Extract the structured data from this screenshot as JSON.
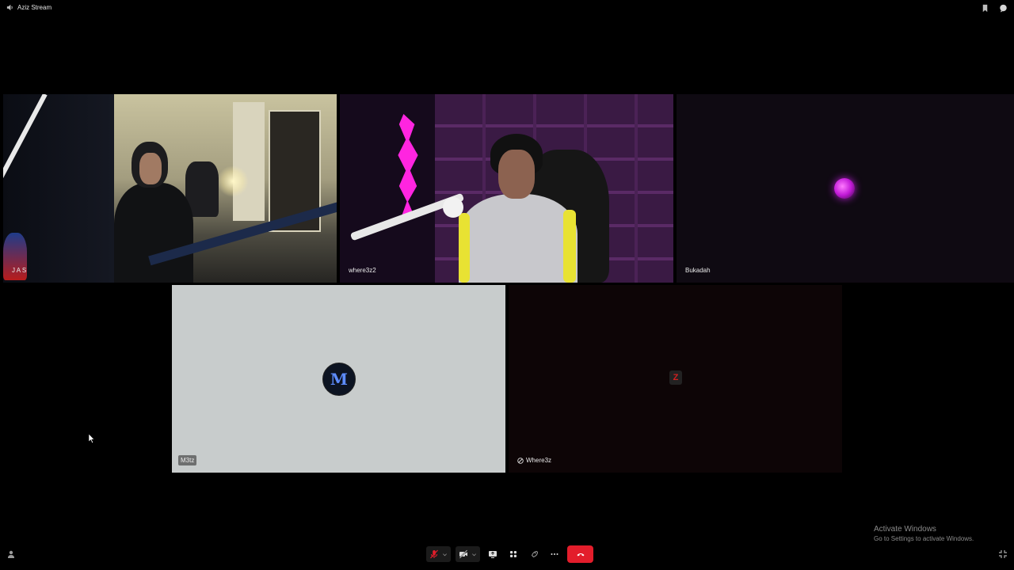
{
  "window": {
    "title": "Aziz Stream"
  },
  "participants": [
    {
      "name": "J A S"
    },
    {
      "name": "where3z2"
    },
    {
      "name": "Bukadah"
    },
    {
      "name": "M3tz"
    },
    {
      "name": "Where3z"
    }
  ],
  "m3tz_avatar_letter": "M",
  "where3z_avatar_letter": "Z",
  "system_watermark": {
    "line1": "Activate Windows",
    "line2": "Go to Settings to activate Windows."
  },
  "toolbar": {
    "buttons": [
      "mic-muted",
      "camera-off",
      "share-screen",
      "apps-grid",
      "activities",
      "more",
      "end-call"
    ]
  },
  "colors": {
    "end_call": "#e31d2b",
    "muted_mic": "#e31d2b",
    "background": "#000000"
  }
}
